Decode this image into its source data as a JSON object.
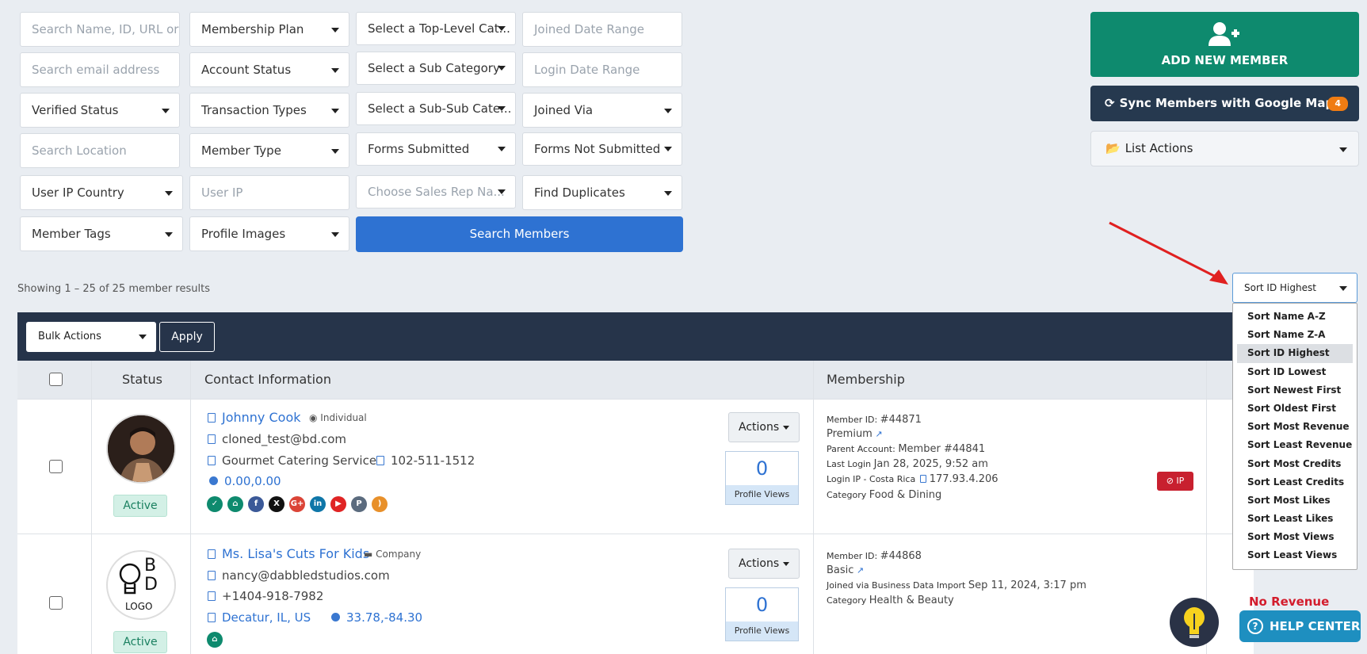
{
  "filters": {
    "search_name_placeholder": "Search Name, ID, URL or",
    "membership_plan": "Membership Plan",
    "top_category": "Select a Top-Level Cat...",
    "joined_date_placeholder": "Joined Date Range",
    "search_email_placeholder": "Search email address",
    "account_status": "Account Status",
    "sub_category": "Select a Sub Category",
    "login_date_placeholder": "Login Date Range",
    "verified_status": "Verified Status",
    "transaction_types": "Transaction Types",
    "sub_sub_category": "Select a Sub-Sub Cate...",
    "joined_via": "Joined Via",
    "search_location_placeholder": "Search Location",
    "member_type": "Member Type",
    "forms_submitted": "Forms Submitted",
    "forms_not_submitted": "Forms Not Submitted",
    "user_ip_country": "User IP Country",
    "user_ip_placeholder": "User IP",
    "sales_rep": "Choose Sales Rep Na...",
    "find_duplicates": "Find Duplicates",
    "member_tags": "Member Tags",
    "profile_images": "Profile Images",
    "search_button": "Search Members"
  },
  "side": {
    "add_member": "ADD NEW MEMBER",
    "sync": "Sync Members with Google Maps",
    "sync_badge": "4",
    "list_actions": "List Actions"
  },
  "results": {
    "showing": "Showing 1 – 25 of 25 member results"
  },
  "sort": {
    "selected": "Sort ID Highest",
    "options": [
      "Sort Name A-Z",
      "Sort Name Z-A",
      "Sort ID Highest",
      "Sort ID Lowest",
      "Sort Newest First",
      "Sort Oldest First",
      "Sort Most Revenue",
      "Sort Least Revenue",
      "Sort Most Credits",
      "Sort Least Credits",
      "Sort Most Likes",
      "Sort Least Likes",
      "Sort Most Views",
      "Sort Least Views"
    ]
  },
  "toolbar": {
    "bulk_actions": "Bulk Actions",
    "apply": "Apply"
  },
  "table": {
    "headers": {
      "status": "Status",
      "contact": "Contact Information",
      "membership": "Membership"
    },
    "rows": [
      {
        "status": "Active",
        "name": "Johnny Cook",
        "type": "Individual",
        "email": "cloned_test@bd.com",
        "company": "Gourmet Catering Service",
        "phone": "102-511-1512",
        "coords": "0.00,0.00",
        "actions": "Actions",
        "views": "0",
        "views_label": "Profile Views",
        "member_id_label": "Member ID:",
        "member_id": "#44871",
        "plan": "Premium",
        "parent_label": "Parent Account:",
        "parent": "Member #44841",
        "last_login_label": "Last Login",
        "last_login": "Jan 28, 2025, 9:52 am",
        "login_ip_label": "Login IP - Costa Rica",
        "login_ip": "177.93.4.206",
        "category_label": "Category",
        "category": "Food & Dining",
        "ip_badge": "IP"
      },
      {
        "status": "Active",
        "name": "Ms. Lisa's Cuts For Kids",
        "type": "Company",
        "email": "nancy@dabbledstudios.com",
        "phone": "+1404-918-7982",
        "location": "Decatur, IL, US",
        "coords": "33.78,-84.30",
        "actions": "Actions",
        "views": "0",
        "views_label": "Profile Views",
        "member_id_label": "Member ID:",
        "member_id": "#44868",
        "plan": "Basic",
        "joined_label": "Joined via Business Data Import",
        "joined": "Sep 11, 2024, 3:17 pm",
        "category_label": "Category",
        "category": "Health & Beauty",
        "revenue": "No Revenue"
      }
    ],
    "logo": {
      "line1": "B",
      "line2": "D",
      "line3": "LOGO"
    }
  },
  "help": {
    "label": "HELP CENTER",
    "q": "?"
  },
  "colors": {
    "primary": "#2e72d2",
    "green": "#0e8a6e",
    "dark": "#26344a",
    "red": "#c8202f"
  }
}
